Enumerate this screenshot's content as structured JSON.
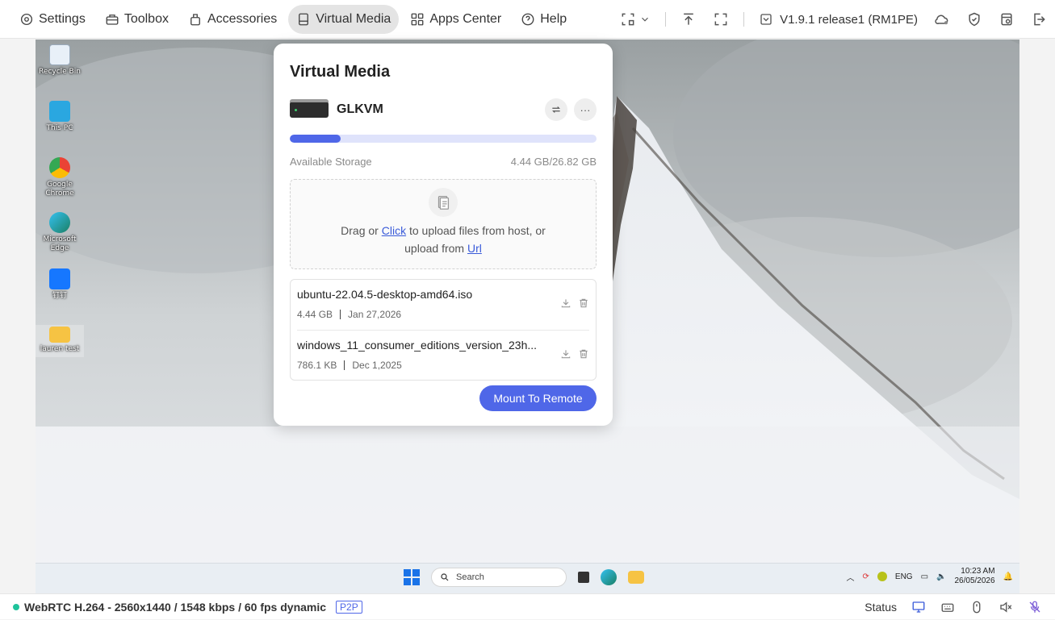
{
  "nav": {
    "settings": "Settings",
    "toolbox": "Toolbox",
    "accessories": "Accessories",
    "virtual_media": "Virtual Media",
    "apps_center": "Apps Center",
    "help": "Help"
  },
  "toolbar": {
    "version": "V1.9.1 release1 (RM1PE)"
  },
  "desktop_icons": [
    {
      "label": "Recycle Bin"
    },
    {
      "label": "This PC"
    },
    {
      "label": "Google Chrome"
    },
    {
      "label": "Microsoft Edge"
    },
    {
      "label": "钉钉"
    },
    {
      "label": "lauren test"
    }
  ],
  "taskbar": {
    "search_placeholder": "Search",
    "lang": "ENG",
    "time": "10:23 AM",
    "date": "26/05/2026"
  },
  "vm": {
    "title": "Virtual Media",
    "device_name": "GLKVM",
    "used_fraction": 0.166,
    "storage_label": "Available Storage",
    "storage_value": "4.44 GB/26.82 GB",
    "drop_pre": "Drag or ",
    "drop_click": "Click",
    "drop_mid": " to upload files from host, or",
    "drop_line2_pre": "upload from ",
    "drop_url": "Url",
    "files": [
      {
        "name": "ubuntu-22.04.5-desktop-amd64.iso",
        "size": "4.44 GB",
        "date": "Jan 27,2026"
      },
      {
        "name": "windows_11_consumer_editions_version_23h...",
        "size": "786.1 KB",
        "date": "Dec 1,2025"
      }
    ],
    "mount_label": "Mount To Remote",
    "more_label": "···"
  },
  "status": {
    "stream": "WebRTC H.264 - 2560x1440 / 1548 kbps / 60 fps dynamic",
    "mode": "P2P",
    "status_label": "Status"
  },
  "colors": {
    "accent": "#4f67e8",
    "online": "#1fc39b"
  }
}
